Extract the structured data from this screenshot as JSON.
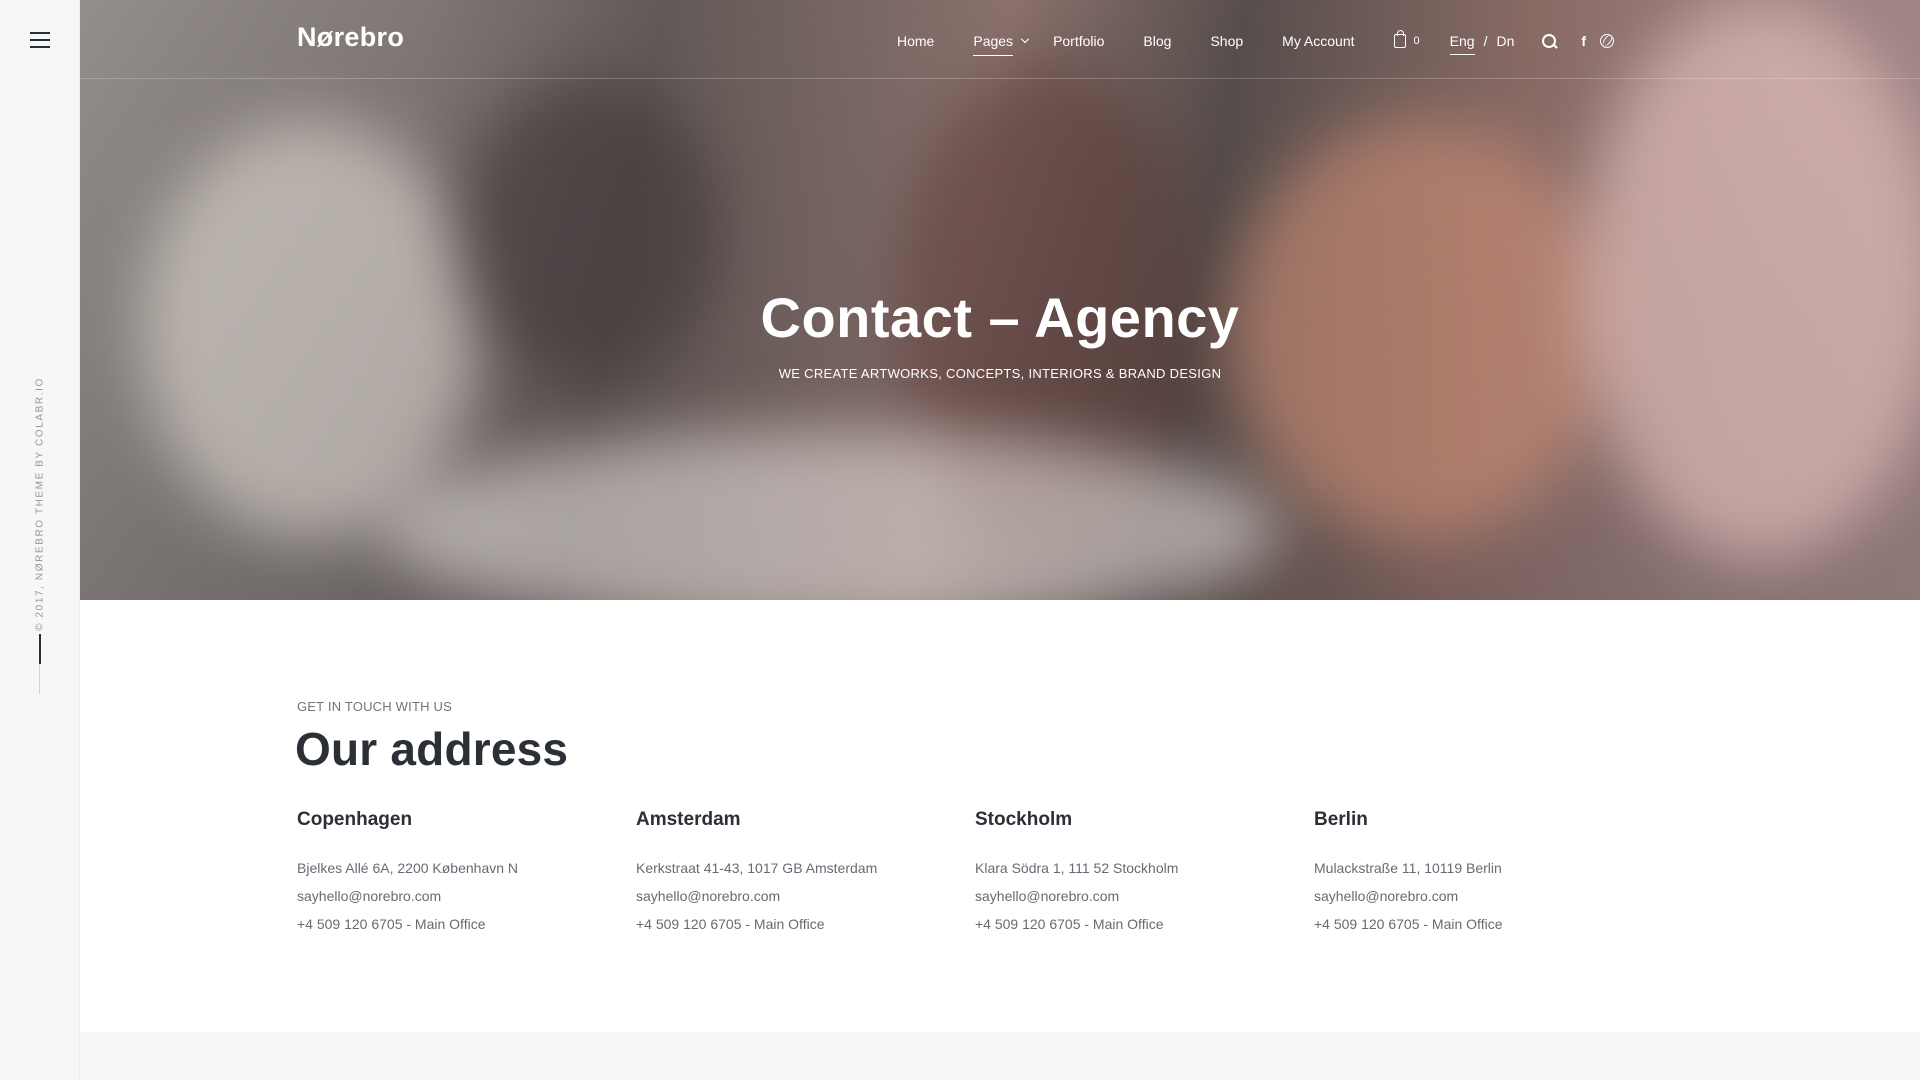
{
  "sidebar": {
    "copyright": "© 2017, NØREBRO THEME BY COLABR.IO"
  },
  "header": {
    "logo": "Nørebro",
    "nav": {
      "home": "Home",
      "pages": "Pages",
      "portfolio": "Portfolio",
      "blog": "Blog",
      "shop": "Shop",
      "account": "My Account"
    },
    "cart_count": "0",
    "lang": {
      "eng": "Eng",
      "separator": "/",
      "dn": "Dn"
    },
    "facebook_glyph": "f"
  },
  "hero": {
    "title": "Contact – Agency",
    "subtitle": "We create artworks, concepts, interiors & brand design"
  },
  "address": {
    "eyebrow": "Get in touch with us",
    "title": "Our address",
    "offices": [
      {
        "city": "Copenhagen",
        "street": "Bjelkes Allé 6A, 2200 København N",
        "email": "sayhello@norebro.com",
        "phone": "+4 509 120 6705 - Main Office"
      },
      {
        "city": "Amsterdam",
        "street": "Kerkstraat 41-43, 1017 GB Amsterdam",
        "email": "sayhello@norebro.com",
        "phone": "+4 509 120 6705 - Main Office"
      },
      {
        "city": "Stockholm",
        "street": "Klara Södra 1, 111 52 Stockholm",
        "email": "sayhello@norebro.com",
        "phone": "+4 509 120 6705 - Main Office"
      },
      {
        "city": "Berlin",
        "street": "Mulackstraße 11, 10119 Berlin",
        "email": "sayhello@norebro.com",
        "phone": "+4 509 120 6705 - Main Office"
      }
    ]
  },
  "icons": {
    "menu": "hamburger-menu-icon",
    "cart": "shopping-bag-icon",
    "search": "search-icon",
    "facebook": "facebook-icon",
    "dribbble": "dribbble-icon"
  },
  "colors": {
    "text_dark": "#2b2f36",
    "text_muted": "#666b73",
    "rail_bg": "#f7f7f7",
    "hero_text": "#ffffff"
  }
}
